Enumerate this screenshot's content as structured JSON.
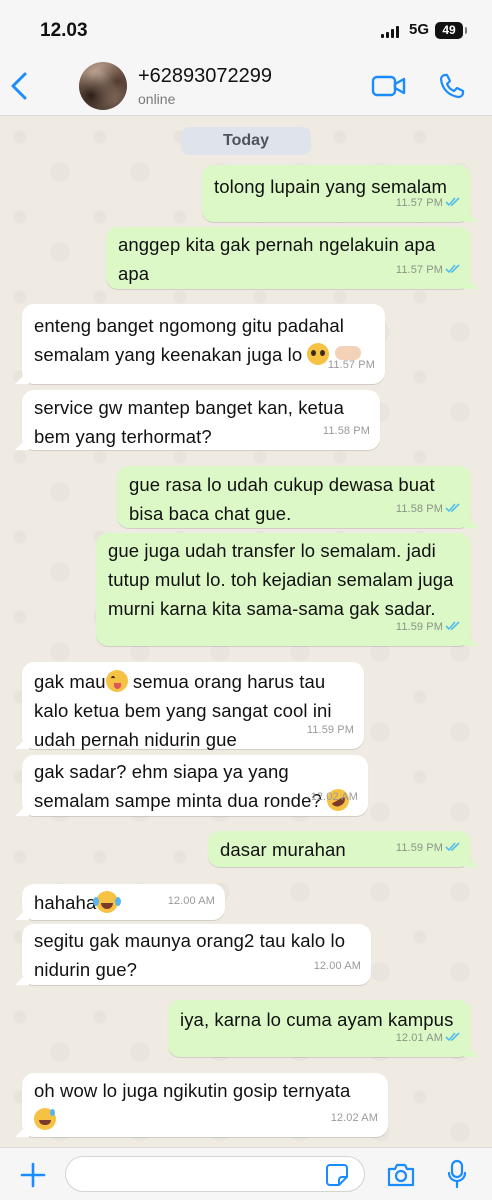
{
  "status_bar": {
    "time": "12.03",
    "network": "5G",
    "battery": "49"
  },
  "header": {
    "back_icon": "chevron-left-icon",
    "contact_name": "+62893072299",
    "contact_status": "online",
    "video_icon": "video-call-icon",
    "call_icon": "phone-icon",
    "accent_color": "#1a8cff"
  },
  "chat": {
    "date_label": "Today",
    "outgoing_color": "#dcf8c6",
    "incoming_color": "#ffffff",
    "messages": [
      {
        "direction": "out",
        "text": "tolong lupain yang semalam",
        "time": "11.57 PM",
        "read": true
      },
      {
        "direction": "out",
        "text": "anggep kita gak pernah ngelakuin apa apa",
        "time": "11.57 PM",
        "read": true
      },
      {
        "direction": "in",
        "text": "enteng banget ngomong gitu padahal semalam yang keenakan juga lo",
        "emoji": "pleading-face-icon + backhand-index-left-icon",
        "time": "11.57 PM"
      },
      {
        "direction": "in",
        "text": "service gw mantep banget kan, ketua bem yang terhormat?",
        "time": "11.58 PM"
      },
      {
        "direction": "out",
        "text": "gue rasa lo udah cukup dewasa buat bisa baca chat gue.",
        "time": "11.58 PM",
        "read": true
      },
      {
        "direction": "out",
        "text": "gue juga udah transfer lo semalam. jadi tutup mulut lo. toh kejadian semalam juga murni karna kita sama-sama gak sadar.",
        "time": "11.59 PM",
        "read": true
      },
      {
        "direction": "in",
        "text_before": "gak mau",
        "emoji": "yum-face-icon",
        "text": " semua orang harus tau kalo ketua bem yang sangat cool ini udah pernah nidurin gue",
        "time": "11.59 PM"
      },
      {
        "direction": "in",
        "text": "gak sadar? ehm siapa ya yang semalam sampe minta dua ronde?",
        "emoji": "rofl-face-icon",
        "time": "12.02 AM"
      },
      {
        "direction": "out",
        "text": "dasar murahan",
        "time": "11.59 PM",
        "read": true
      },
      {
        "direction": "in",
        "text": "hahaha",
        "emoji": "joy-face-icon",
        "time": "12.00 AM"
      },
      {
        "direction": "in",
        "text": "segitu gak maunya orang2 tau kalo lo nidurin gue?",
        "time": "12.00 AM"
      },
      {
        "direction": "out",
        "text": "iya, karna lo cuma ayam kampus",
        "time": "12.01 AM",
        "read": true
      },
      {
        "direction": "in",
        "text": "oh wow lo juga ngikutin gosip ternyata",
        "emoji": "sweat-smile-face-icon",
        "time": "12.02 AM"
      }
    ]
  },
  "input_bar": {
    "message_value": "",
    "plus_icon": "plus-icon",
    "sticker_icon": "sticker-icon",
    "camera_icon": "camera-icon",
    "mic_icon": "microphone-icon"
  }
}
